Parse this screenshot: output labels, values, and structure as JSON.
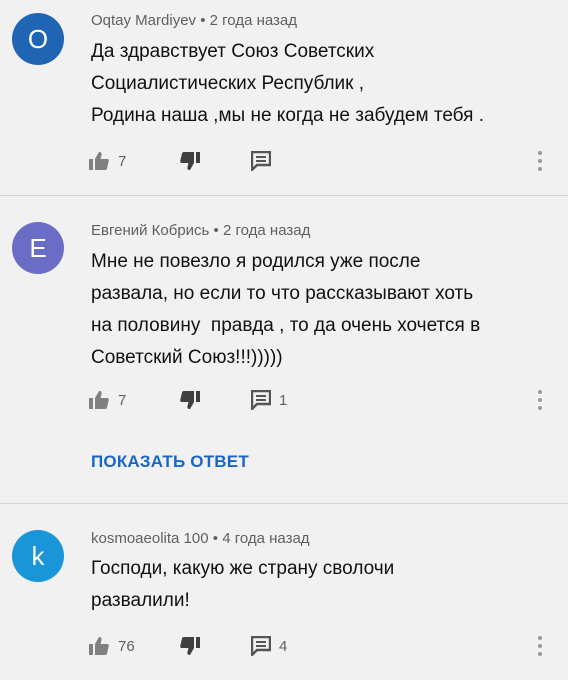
{
  "comments": [
    {
      "avatar_letter": "O",
      "avatar_color": "#1f65b4",
      "author": "Oqtay Mardiyev",
      "time": "2 года назад",
      "text": "Да здравствует Союз Советских\nСоциалистических Республик ,\nРодина наша ,мы не когда не забудем тебя .",
      "likes": "7",
      "replies": ""
    },
    {
      "avatar_letter": "E",
      "avatar_color": "#6a6cc6",
      "author": "Евгений Кобрись",
      "time": "2 года назад",
      "text": "Мне не повезло я родился уже после\nразвала, но если то что рассказывают хоть\nна половину  правда , то да очень хочется в\nСоветский Союз!!!)))))",
      "likes": "7",
      "replies": "1"
    },
    {
      "avatar_letter": "k",
      "avatar_color": "#1a95d8",
      "author": "kosmoaeolita 100",
      "time": "4 года назад",
      "text": "Господи, какую же страну сволочи\nразвалили!",
      "likes": "76",
      "replies": "4"
    }
  ],
  "meta_separator": "•",
  "show_replies_label": "ПОКАЗАТЬ ОТВЕТ",
  "icons": [
    "thumb-up-icon",
    "thumb-down-icon",
    "reply-icon",
    "more-vert-icon"
  ]
}
